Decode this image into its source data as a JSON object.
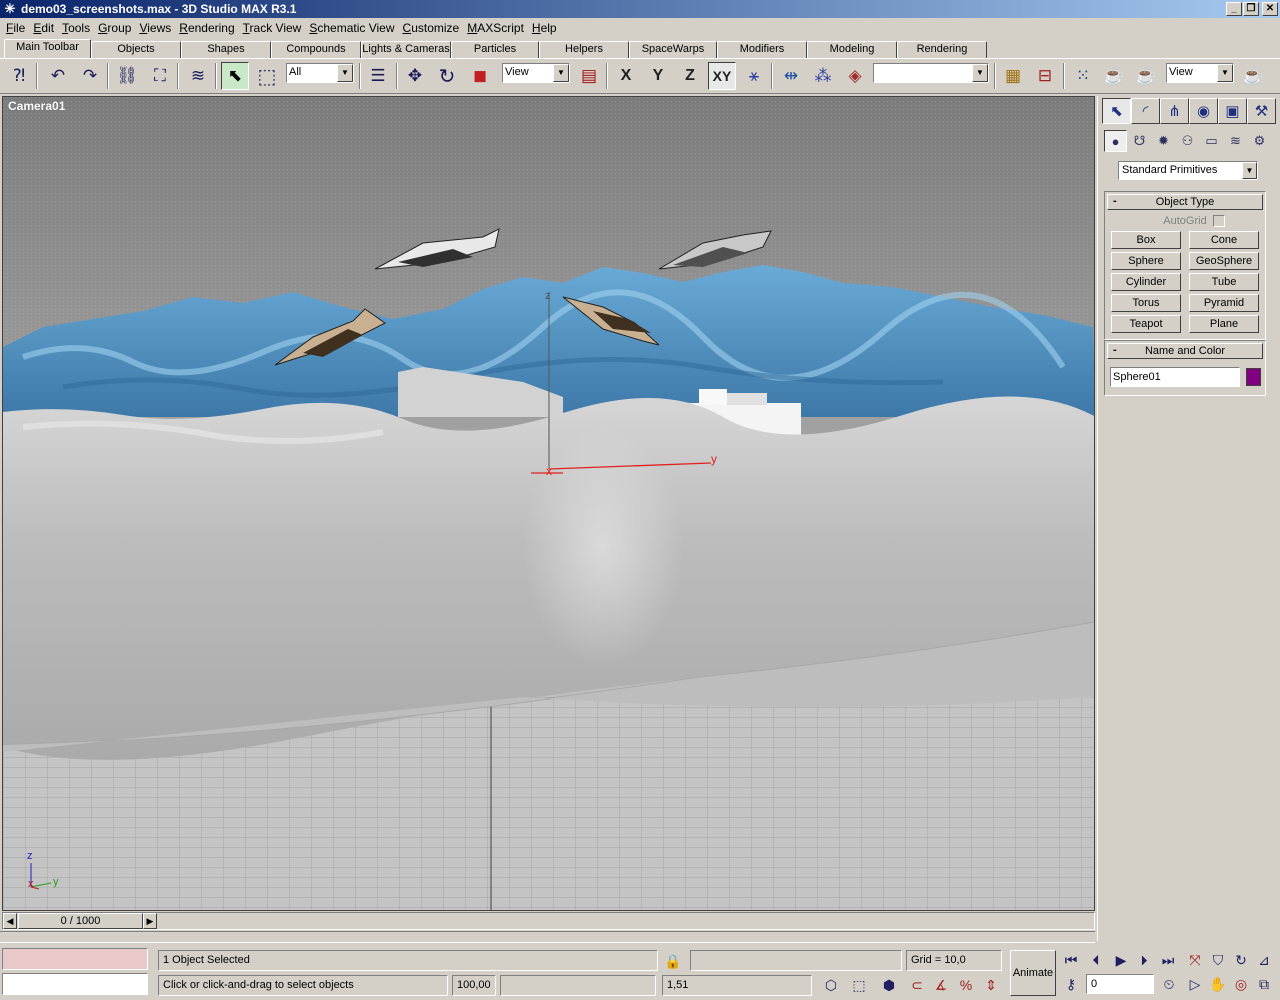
{
  "window": {
    "title": "demo03_screenshots.max - 3D Studio MAX R3.1",
    "minimize": "_",
    "maximize": "❐",
    "close": "✕"
  },
  "menu": [
    "File",
    "Edit",
    "Tools",
    "Group",
    "Views",
    "Rendering",
    "Track View",
    "Schematic View",
    "Customize",
    "MAXScript",
    "Help"
  ],
  "tabs": [
    "Main Toolbar",
    "Objects",
    "Shapes",
    "Compounds",
    "Lights & Cameras",
    "Particles",
    "Helpers",
    "SpaceWarps",
    "Modifiers",
    "Modeling",
    "Rendering"
  ],
  "toolbar": {
    "selection_filter": "All",
    "ref_coord": "View",
    "named_selection": "",
    "render_type": "View",
    "axis_x": "X",
    "axis_y": "Y",
    "axis_z": "Z",
    "axis_xy": "XY"
  },
  "viewport": {
    "label": "Camera01",
    "gizmo_x": "x",
    "gizmo_y": "y",
    "gizmo_z": "z",
    "corner_x": "x",
    "corner_y": "y",
    "corner_z": "z"
  },
  "command_panel": {
    "category_dropdown": "Standard Primitives",
    "object_type": {
      "title": "Object Type",
      "autogrid": "AutoGrid",
      "buttons": [
        "Box",
        "Cone",
        "Sphere",
        "GeoSphere",
        "Cylinder",
        "Tube",
        "Torus",
        "Pyramid",
        "Teapot",
        "Plane"
      ]
    },
    "name_and_color": {
      "title": "Name and Color",
      "name": "Sphere01",
      "color": "#800080"
    }
  },
  "time_slider": {
    "position": "0 / 1000",
    "current_frame": 0,
    "total_frames": 1000
  },
  "status": {
    "selection": "1 Object Selected",
    "prompt": "Click or click-and-drag to select objects",
    "x_value": "100,00",
    "z_value": "1,51",
    "grid": "Grid = 10,0",
    "animate": "Animate",
    "frame": "0"
  },
  "colors": {
    "desktop": "#d4d0c8",
    "titlebar": "#0a246a",
    "mountains": "#5a9ac8",
    "terrain": "#c8c8c8",
    "sky_top": "#7a7a7a",
    "sky_bottom": "#d8d8d8"
  }
}
